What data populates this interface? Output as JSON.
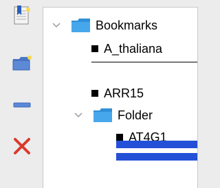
{
  "toolbar": {
    "buttons": [
      {
        "name": "add-bookmark",
        "icon": "bookmark-add-icon"
      },
      {
        "name": "add-folder",
        "icon": "folder-add-icon"
      },
      {
        "name": "add-separator",
        "icon": "separator-icon"
      },
      {
        "name": "delete",
        "icon": "delete-x-icon"
      }
    ]
  },
  "tree": {
    "root": {
      "label": "Bookmarks",
      "expanded": true
    },
    "items": [
      {
        "label": "A_thaliana"
      },
      {
        "label": "ARR15"
      }
    ],
    "folder": {
      "label": "Folder",
      "expanded": true,
      "items": [
        {
          "label": "AT4G1"
        }
      ]
    }
  },
  "colors": {
    "folder": "#3ea0e6",
    "selection": "#2350d7",
    "delete": "#d93a2b",
    "separator_icon": "#4a7bd0"
  }
}
